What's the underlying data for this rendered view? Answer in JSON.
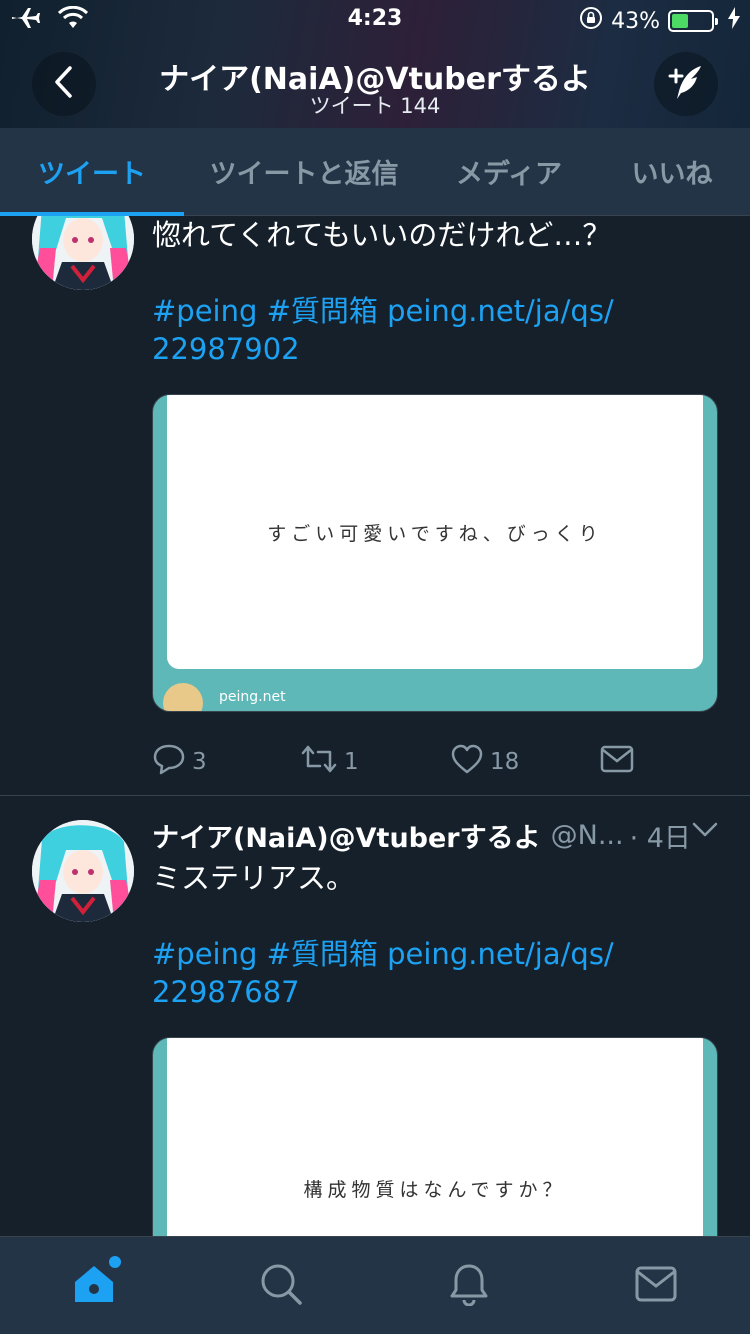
{
  "status_bar": {
    "time": "4:23",
    "battery_percent": "43%",
    "battery_level": 0.43,
    "icons": [
      "airplane-icon",
      "wifi-icon",
      "rotation-lock-icon",
      "battery-icon",
      "charging-icon"
    ]
  },
  "header": {
    "title": "ナイア(NaiA)@Vtuberするよ",
    "subtitle": "ツイート 144",
    "back_icon": "chevron-left-icon",
    "compose_icon": "compose-tweet-icon"
  },
  "tabs": [
    {
      "label": "ツイート",
      "active": true
    },
    {
      "label": "ツイートと返信",
      "active": false
    },
    {
      "label": "メディア",
      "active": false
    },
    {
      "label": "いいね",
      "active": false
    }
  ],
  "tweets": [
    {
      "text": "惚れてくれてもいいのだけれど…？",
      "link_line1": "#peing #質問箱 peing.net/ja/qs/",
      "link_line2": "22987902",
      "card_text": "すごい可愛いですね、びっくり",
      "card_domain": "peing.net",
      "replies": "3",
      "retweets": "1",
      "likes": "18"
    },
    {
      "author_name": "ナイア(NaiA)@Vtuberするよ",
      "handle": "@N...",
      "time": "· 4日",
      "text": "ミステリアス。",
      "link_line1": "#peing #質問箱 peing.net/ja/qs/",
      "link_line2": "22987687",
      "card_text": "構成物質はなんですか？"
    }
  ],
  "bottom_nav": [
    {
      "icon": "home-icon",
      "active": true
    },
    {
      "icon": "search-icon",
      "active": false
    },
    {
      "icon": "notifications-icon",
      "active": false
    },
    {
      "icon": "messages-icon",
      "active": false
    }
  ],
  "colors": {
    "background": "#15202b",
    "bar": "#243447",
    "accent": "#1da1f2",
    "muted": "#8899a6",
    "card_teal": "#5fb8b8"
  }
}
